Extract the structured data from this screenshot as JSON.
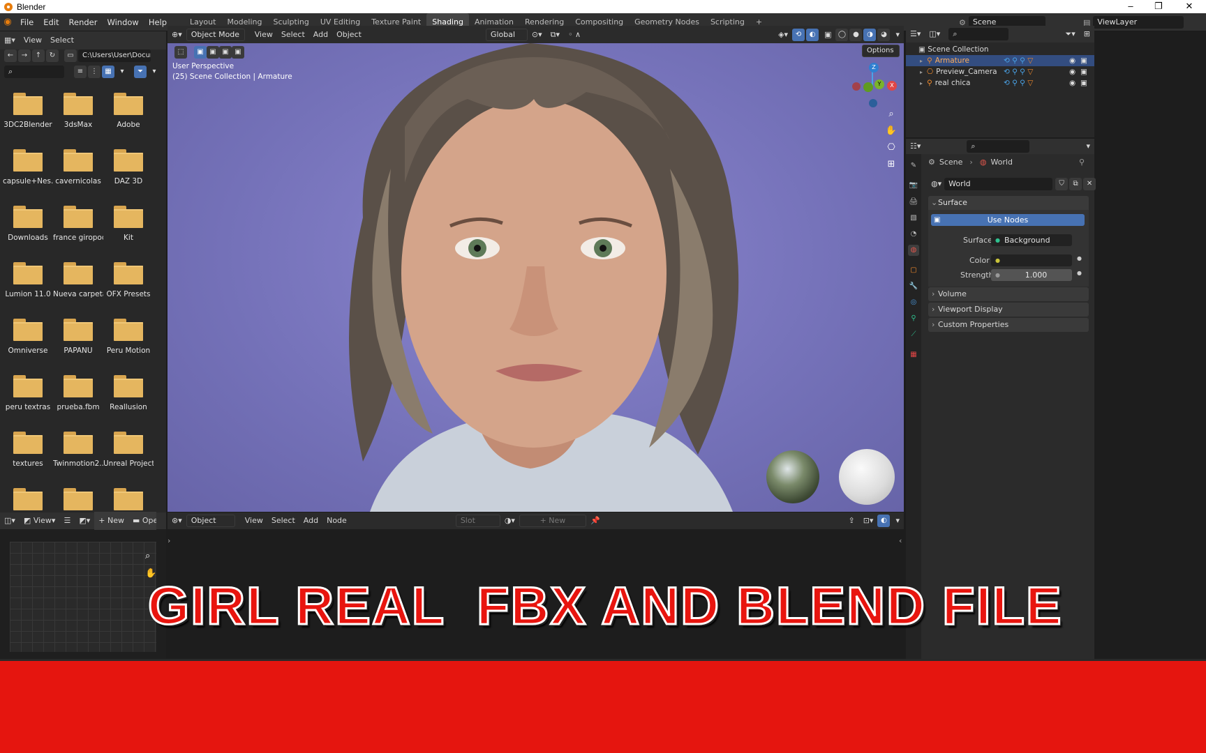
{
  "window": {
    "title": "Blender",
    "minimize": "–",
    "maximize": "❐",
    "close": "✕"
  },
  "menu": [
    "File",
    "Edit",
    "Render",
    "Window",
    "Help"
  ],
  "workspaces": [
    "Layout",
    "Modeling",
    "Sculpting",
    "UV Editing",
    "Texture Paint",
    "Shading",
    "Animation",
    "Rendering",
    "Compositing",
    "Geometry Nodes",
    "Scripting"
  ],
  "active_workspace": "Shading",
  "add_workspace": "+",
  "scene_field": "Scene",
  "viewlayer_field": "ViewLayer",
  "file_browser": {
    "menu": [
      "View",
      "Select"
    ],
    "path": "C:\\Users\\User\\Docum...",
    "folders": [
      "3DC2Blender",
      "3dsMax",
      "Adobe",
      "capsule+Nes...",
      "cavernicolas",
      "DAZ 3D",
      "Downloads",
      "france giropod",
      "Kit",
      "Lumion 11.0",
      "Nueva carpeta",
      "OFX Presets",
      "Omniverse",
      "PAPANU",
      "Peru Motion",
      "peru textras",
      "prueba.fbm",
      "Reallusion",
      "textures",
      "Twinmotion2...",
      "Unreal Project",
      "",
      "",
      ""
    ]
  },
  "viewport": {
    "mode": "Object Mode",
    "menu": [
      "View",
      "Select",
      "Add",
      "Object"
    ],
    "orientation": "Global",
    "options": "Options",
    "overlay_line1": "User Perspective",
    "overlay_line2": "(25) Scene Collection | Armature",
    "gizmo": {
      "z": "Z",
      "y": "Y",
      "x": "X"
    }
  },
  "image_editor": {
    "view": "View",
    "new": "New",
    "open": "Oper"
  },
  "node_editor": {
    "type": "Object",
    "menu": [
      "View",
      "Select",
      "Add",
      "Node"
    ],
    "slot": "Slot",
    "new": "New"
  },
  "outliner": {
    "root": "Scene Collection",
    "items": [
      {
        "name": "Armature",
        "selected": true
      },
      {
        "name": "Preview_Camera",
        "selected": false
      },
      {
        "name": "real chica",
        "selected": false
      }
    ]
  },
  "properties": {
    "breadcrumb": [
      "Scene",
      "World"
    ],
    "world_name": "World",
    "surface_panel": "Surface",
    "use_nodes": "Use Nodes",
    "surface_label": "Surface",
    "surface_value": "Background",
    "color_label": "Color",
    "strength_label": "Strength",
    "strength_value": "1.000",
    "collapsed_panels": [
      "Volume",
      "Viewport Display",
      "Custom Properties"
    ]
  },
  "overlay_title": "GIRL REAL  FBX AND BLEND FILE",
  "colors": {
    "accent": "#4772b3",
    "title_red": "#e8150f",
    "selected_row": "#334d80"
  }
}
